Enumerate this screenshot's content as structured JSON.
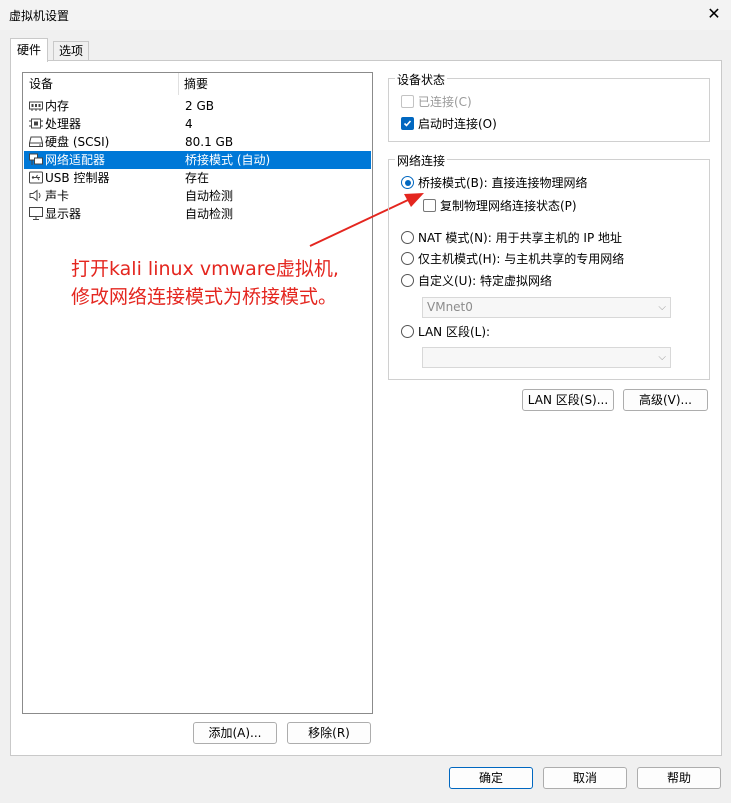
{
  "window": {
    "title": "虚拟机设置",
    "close_icon": "close-icon"
  },
  "tabs": [
    {
      "label": "硬件",
      "active": true
    },
    {
      "label": "选项",
      "active": false
    }
  ],
  "device_list": {
    "headers": {
      "device": "设备",
      "summary": "摘要"
    },
    "rows": [
      {
        "icon": "memory-icon",
        "name": "内存",
        "summary": "2 GB"
      },
      {
        "icon": "cpu-icon",
        "name": "处理器",
        "summary": "4"
      },
      {
        "icon": "disk-icon",
        "name": "硬盘 (SCSI)",
        "summary": "80.1 GB"
      },
      {
        "icon": "network-icon",
        "name": "网络适配器",
        "summary": "桥接模式 (自动)",
        "selected": true
      },
      {
        "icon": "usb-icon",
        "name": "USB 控制器",
        "summary": "存在"
      },
      {
        "icon": "sound-icon",
        "name": "声卡",
        "summary": "自动检测"
      },
      {
        "icon": "display-icon",
        "name": "显示器",
        "summary": "自动检测"
      }
    ]
  },
  "left_buttons": {
    "add": "添加(A)...",
    "remove": "移除(R)"
  },
  "device_status": {
    "title": "设备状态",
    "connected": {
      "label": "已连接(C)",
      "checked": false,
      "enabled": false
    },
    "connect_on_power": {
      "label": "启动时连接(O)",
      "checked": true
    }
  },
  "network": {
    "title": "网络连接",
    "bridged": {
      "label": "桥接模式(B): 直接连接物理网络",
      "selected": true
    },
    "replicate": {
      "label": "复制物理网络连接状态(P)",
      "checked": false
    },
    "nat": {
      "label": "NAT 模式(N): 用于共享主机的 IP 地址"
    },
    "hostonly": {
      "label": "仅主机模式(H): 与主机共享的专用网络"
    },
    "custom": {
      "label": "自定义(U): 特定虚拟网络",
      "combo_value": "VMnet0"
    },
    "lan": {
      "label": "LAN 区段(L):",
      "combo_value": ""
    }
  },
  "right_buttons": {
    "lan_segments": "LAN 区段(S)...",
    "advanced": "高级(V)..."
  },
  "bottom_buttons": {
    "ok": "确定",
    "cancel": "取消",
    "help": "帮助"
  },
  "annotation": {
    "line1": "打开kali linux vmware虚拟机,",
    "line2": "修改网络连接模式为桥接模式。",
    "color": "#e4261f"
  },
  "colors": {
    "accent": "#0067c0",
    "selection": "#0078d7"
  }
}
